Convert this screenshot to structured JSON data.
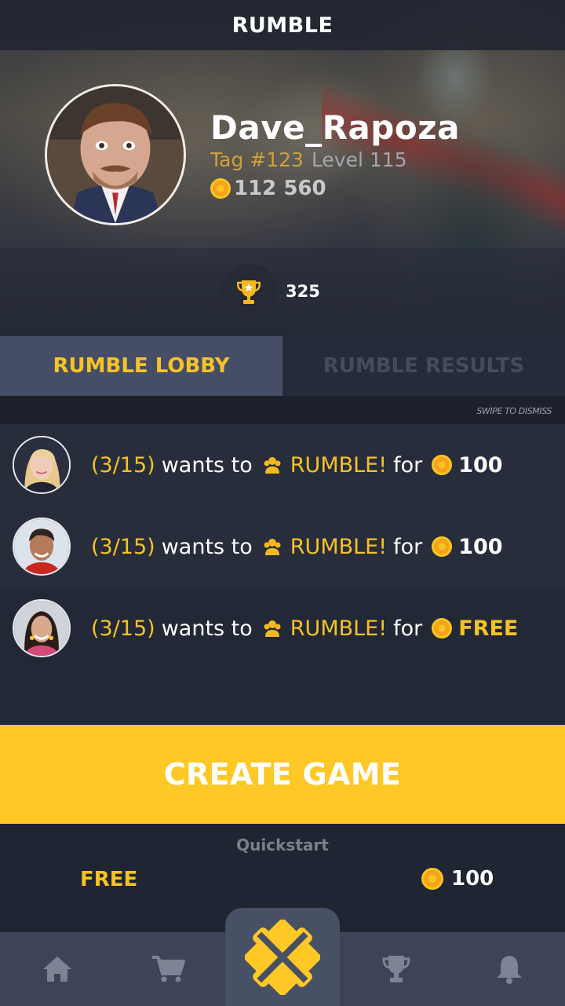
{
  "header": {
    "title": "RUMBLE"
  },
  "profile": {
    "username": "Dave_Rapoza",
    "tag": "Tag #123",
    "level": "Level 115",
    "coins": "112 560",
    "trophies": "325"
  },
  "tabs": [
    {
      "label": "RUMBLE LOBBY",
      "active": true
    },
    {
      "label": "RUMBLE RESULTS",
      "active": false
    }
  ],
  "dismiss_hint": "SWIPE TO DISMISS",
  "invites": [
    {
      "count": "(3/15)",
      "wants": "wants to",
      "action": "RUMBLE!",
      "for": "for",
      "stake": "100",
      "stake_is_free": false
    },
    {
      "count": "(3/15)",
      "wants": "wants to",
      "action": "RUMBLE!",
      "for": "for",
      "stake": "100",
      "stake_is_free": false
    },
    {
      "count": "(3/15)",
      "wants": "wants to",
      "action": "RUMBLE!",
      "for": "for",
      "stake": "FREE",
      "stake_is_free": true
    }
  ],
  "create_button": "CREATE GAME",
  "quickstart": {
    "label": "Quickstart",
    "free_option": "FREE",
    "coin_option": "100"
  },
  "nav": {
    "items": [
      "home-icon",
      "cart-icon",
      "rumble-logo-icon",
      "trophy-icon",
      "bell-icon"
    ]
  },
  "colors": {
    "accent_yellow": "#fec926",
    "text_yellow": "#f5c325",
    "background": "#232836",
    "tab_active": "#454e66",
    "nav_bar": "#3d4457"
  }
}
